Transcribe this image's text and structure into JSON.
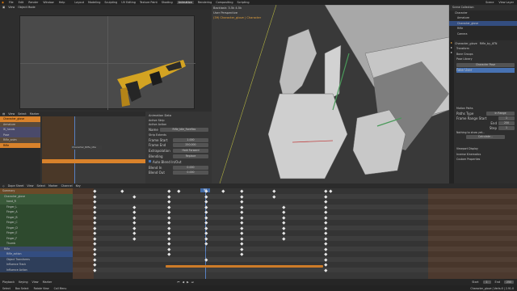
{
  "topbar": {
    "menus": [
      "File",
      "Edit",
      "Render",
      "Window",
      "Help"
    ],
    "workspaces": [
      "Layout",
      "Modeling",
      "Sculpting",
      "UV Editing",
      "Texture Paint",
      "Shading",
      "Animation",
      "Rendering",
      "Compositing",
      "Scripting"
    ],
    "active_workspace": "Animation",
    "scene": "Scene",
    "view_layer": "View Layer"
  },
  "camera_view": {
    "header": [
      "View",
      "View"
    ],
    "mode": "Object Mode"
  },
  "viewport3d": {
    "header": [
      "User Perspective",
      "(39) Character_glove | Character"
    ],
    "stats": "Backlash: 3.5k 4.5k"
  },
  "outliner": {
    "items": [
      "Scene Collection",
      "Character",
      "Armature",
      "Character_glove",
      "Rifle",
      "Camera"
    ]
  },
  "properties": {
    "object": "Character_glove",
    "tab": "Rifle_by_ATN",
    "sections": [
      "Transform",
      "Bone Groups",
      "Pose Library"
    ],
    "motion_paths": "Motion Paths",
    "paths_type": "In Range",
    "frame_range_start": "Frame Range Start",
    "start_val": "1",
    "end": "End",
    "end_val": "250",
    "step": "Step",
    "step_val": "1",
    "calculate": "Calculate...",
    "nothing_to_show": "Nothing to show yet...",
    "viewport_display": "Viewport Display",
    "inverse_kinematics": "Inverse Kinematics",
    "custom_properties": "Custom Properties",
    "character_pose": "Character Pose",
    "fake_user": "Fake User"
  },
  "nla": {
    "header": [
      "View",
      "Select",
      "Marker",
      "Channel",
      "Key"
    ],
    "tracks": [
      "Character_glove",
      "Armature",
      "IK_hands",
      "Pose",
      "Rifle_anim",
      "Rifle"
    ],
    "strip": "Character_Rifle_idle",
    "ruler": [
      "0",
      "25",
      "50",
      "75",
      "100",
      "125",
      "150",
      "175",
      "200",
      "225"
    ]
  },
  "sidebar": {
    "title": "Animation Data",
    "active_strip": "Active Strip",
    "active_action": "Active Action",
    "name": "Name",
    "name_val": "Rifle_Idle_Foreflex",
    "strip_extents": "Strip Extents",
    "frame_start": "Frame Start",
    "frame_start_val": "1.000",
    "frame_end": "Frame End",
    "frame_end_val": "250.000",
    "extrapolation": "Extrapolation",
    "extrapolation_val": "Hold Forward",
    "blending": "Blending",
    "blending_val": "Replace",
    "blend_in": "Blend In",
    "blend_out": "Blend Out",
    "blend_in_val": "0.000",
    "blend_out_val": "0.000",
    "auto_blend": "Auto Blend In/Out"
  },
  "dopesheet": {
    "header": [
      "View",
      "Select",
      "Marker",
      "Channel",
      "Key"
    ],
    "mode": "Dope Sheet",
    "summary": "Summary",
    "channels": [
      "Summary",
      "Character_glove",
      "hand_R",
      "Finger_L",
      "Finger_A",
      "Finger_B",
      "Finger_C",
      "Finger_D",
      "Finger_E",
      "Finger_F",
      "Thumb",
      "Rifle",
      "Rifle_action",
      "Object Transforms",
      "Influence Track",
      "Influence Action"
    ],
    "current_frame": "90",
    "ruler": [
      "0",
      "10",
      "20",
      "30",
      "40",
      "50",
      "60",
      "70",
      "80",
      "90",
      "100",
      "110",
      "120",
      "130",
      "140",
      "150",
      "160",
      "170",
      "180",
      "190",
      "200",
      "210",
      "220"
    ]
  },
  "timeline": {
    "items": [
      "Playback",
      "Keying",
      "View",
      "Marker"
    ],
    "start_label": "Start",
    "start": "1",
    "end_label": "End",
    "end": "250",
    "frame": "90"
  },
  "statusbar": {
    "items": [
      "Select",
      "Box Select",
      "Rotate View",
      "Call Menu"
    ],
    "version": "Character_glove | Verts:0 | 2.91.0"
  },
  "colors": {
    "accent": "#e8a33c",
    "selected": "#4772b3",
    "playhead": "#5680c2",
    "strip_orange": "#d9822b"
  }
}
